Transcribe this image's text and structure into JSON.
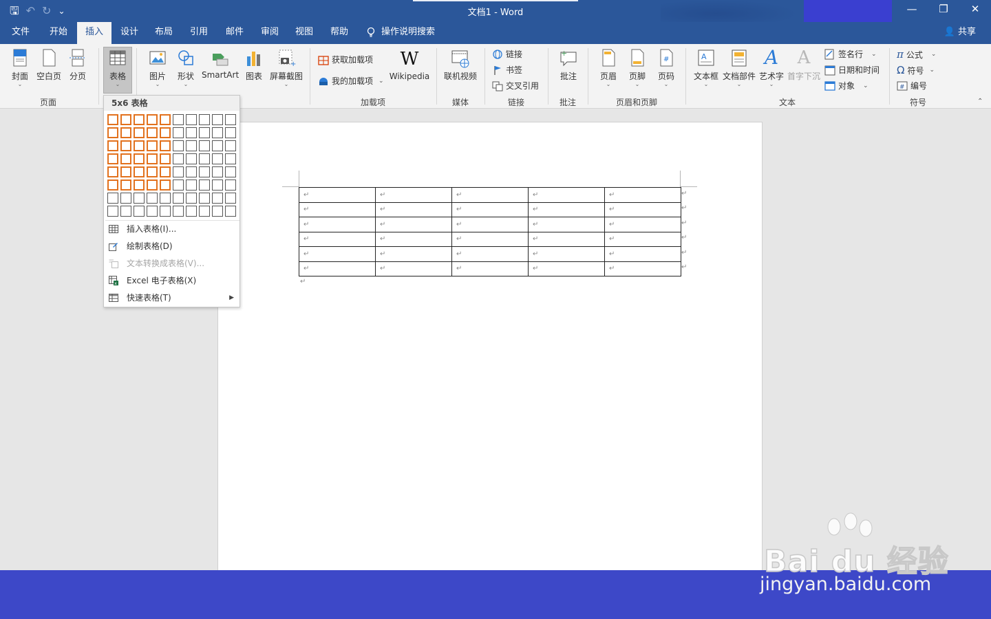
{
  "titlebar": {
    "title": "文档1  -  Word",
    "qat": {
      "save": "🖫",
      "undo": "↶",
      "redo": "↻",
      "more": "⌄"
    }
  },
  "tabs": [
    {
      "label": "文件",
      "active": false
    },
    {
      "label": "开始",
      "active": false
    },
    {
      "label": "插入",
      "active": true
    },
    {
      "label": "设计",
      "active": false
    },
    {
      "label": "布局",
      "active": false
    },
    {
      "label": "引用",
      "active": false
    },
    {
      "label": "邮件",
      "active": false
    },
    {
      "label": "审阅",
      "active": false
    },
    {
      "label": "视图",
      "active": false
    },
    {
      "label": "帮助",
      "active": false
    }
  ],
  "search": {
    "icon": "lightbulb-icon",
    "label": "操作说明搜索"
  },
  "share": {
    "label": "共享"
  },
  "ribbon": {
    "pages": {
      "group": "页面",
      "cover": "封面",
      "blank": "空白页",
      "break": "分页"
    },
    "tables": {
      "table": "表格"
    },
    "illustrations": {
      "picture": "图片",
      "shapes": "形状",
      "smartart": "SmartArt",
      "chart": "图表",
      "screenshot": "屏幕截图"
    },
    "addins": {
      "group": "加载项",
      "get": "获取加载项",
      "mine": "我的加载项",
      "wikipedia": "Wikipedia"
    },
    "media": {
      "group": "媒体",
      "online_video": "联机视频"
    },
    "links": {
      "group": "链接",
      "link": "链接",
      "bookmark": "书签",
      "crossref": "交叉引用"
    },
    "comments": {
      "group": "批注",
      "comment": "批注"
    },
    "headerfooter": {
      "group": "页眉和页脚",
      "header": "页眉",
      "footer": "页脚",
      "pagenum": "页码"
    },
    "text": {
      "group": "文本",
      "textbox": "文本框",
      "quickparts": "文档部件",
      "wordart": "艺术字",
      "dropcap": "首字下沉",
      "signature": "签名行",
      "datetime": "日期和时间",
      "object": "对象"
    },
    "symbols": {
      "group": "符号",
      "equation": "公式",
      "symbol": "符号",
      "number": "编号"
    }
  },
  "dropdown": {
    "header": "5x6 表格",
    "grid_cols": 10,
    "grid_rows": 8,
    "selected_cols": 5,
    "selected_rows": 6,
    "items": [
      {
        "label": "插入表格(I)...",
        "disabled": false
      },
      {
        "label": "绘制表格(D)",
        "disabled": false
      },
      {
        "label": "文本转换成表格(V)...",
        "disabled": true
      },
      {
        "label": "Excel 电子表格(X)",
        "disabled": false
      },
      {
        "label": "快速表格(T)",
        "disabled": false
      }
    ]
  },
  "document": {
    "table_rows": 6,
    "table_cols": 5,
    "cell_mark": "↵"
  },
  "watermark": {
    "logo": "Bai du 经验",
    "url": "jingyan.baidu.com"
  },
  "colors": {
    "accent": "#2b579a",
    "grid_selected": "#e2711d",
    "banner": "#3d48c8"
  }
}
